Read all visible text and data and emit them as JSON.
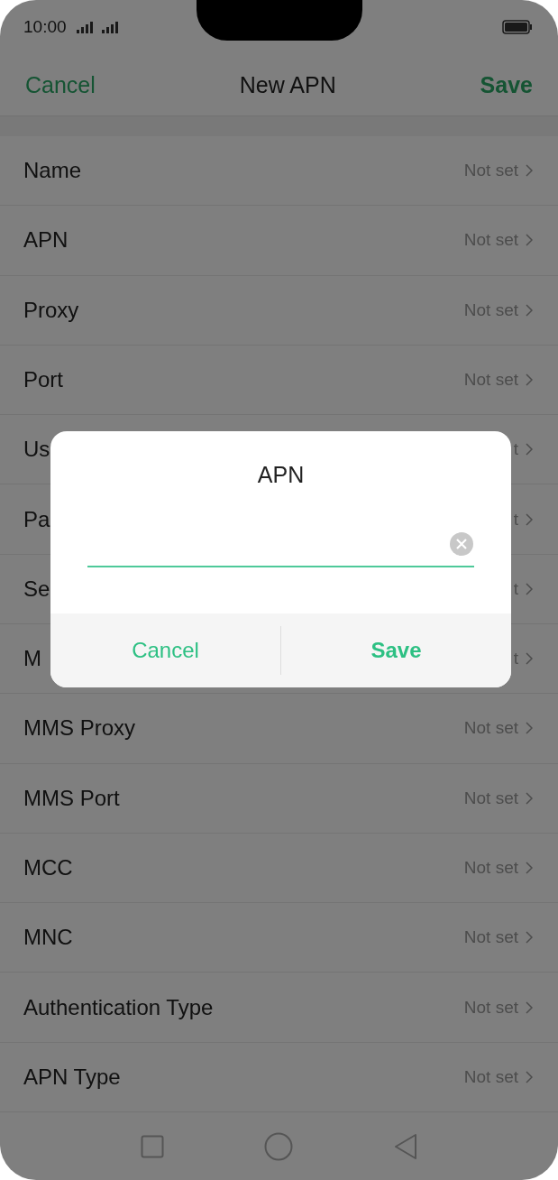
{
  "status_bar": {
    "time": "10:00"
  },
  "header": {
    "cancel": "Cancel",
    "title": "New APN",
    "save": "Save"
  },
  "rows": [
    {
      "label": "Name",
      "value": "Not set"
    },
    {
      "label": "APN",
      "value": "Not set"
    },
    {
      "label": "Proxy",
      "value": "Not set"
    },
    {
      "label": "Port",
      "value": "Not set"
    },
    {
      "label": "Us",
      "value": "t"
    },
    {
      "label": "Pa",
      "value": "t"
    },
    {
      "label": "Se",
      "value": "t"
    },
    {
      "label": "M",
      "value": "t"
    },
    {
      "label": "MMS Proxy",
      "value": "Not set"
    },
    {
      "label": "MMS Port",
      "value": "Not set"
    },
    {
      "label": "MCC",
      "value": "Not set"
    },
    {
      "label": "MNC",
      "value": "Not set"
    },
    {
      "label": "Authentication Type",
      "value": "Not set"
    },
    {
      "label": "APN Type",
      "value": "Not set"
    }
  ],
  "dialog": {
    "title": "APN",
    "buttons": [
      {
        "label": "Cancel",
        "kind": "secondary"
      },
      {
        "label": "Save",
        "kind": "primary"
      }
    ]
  }
}
